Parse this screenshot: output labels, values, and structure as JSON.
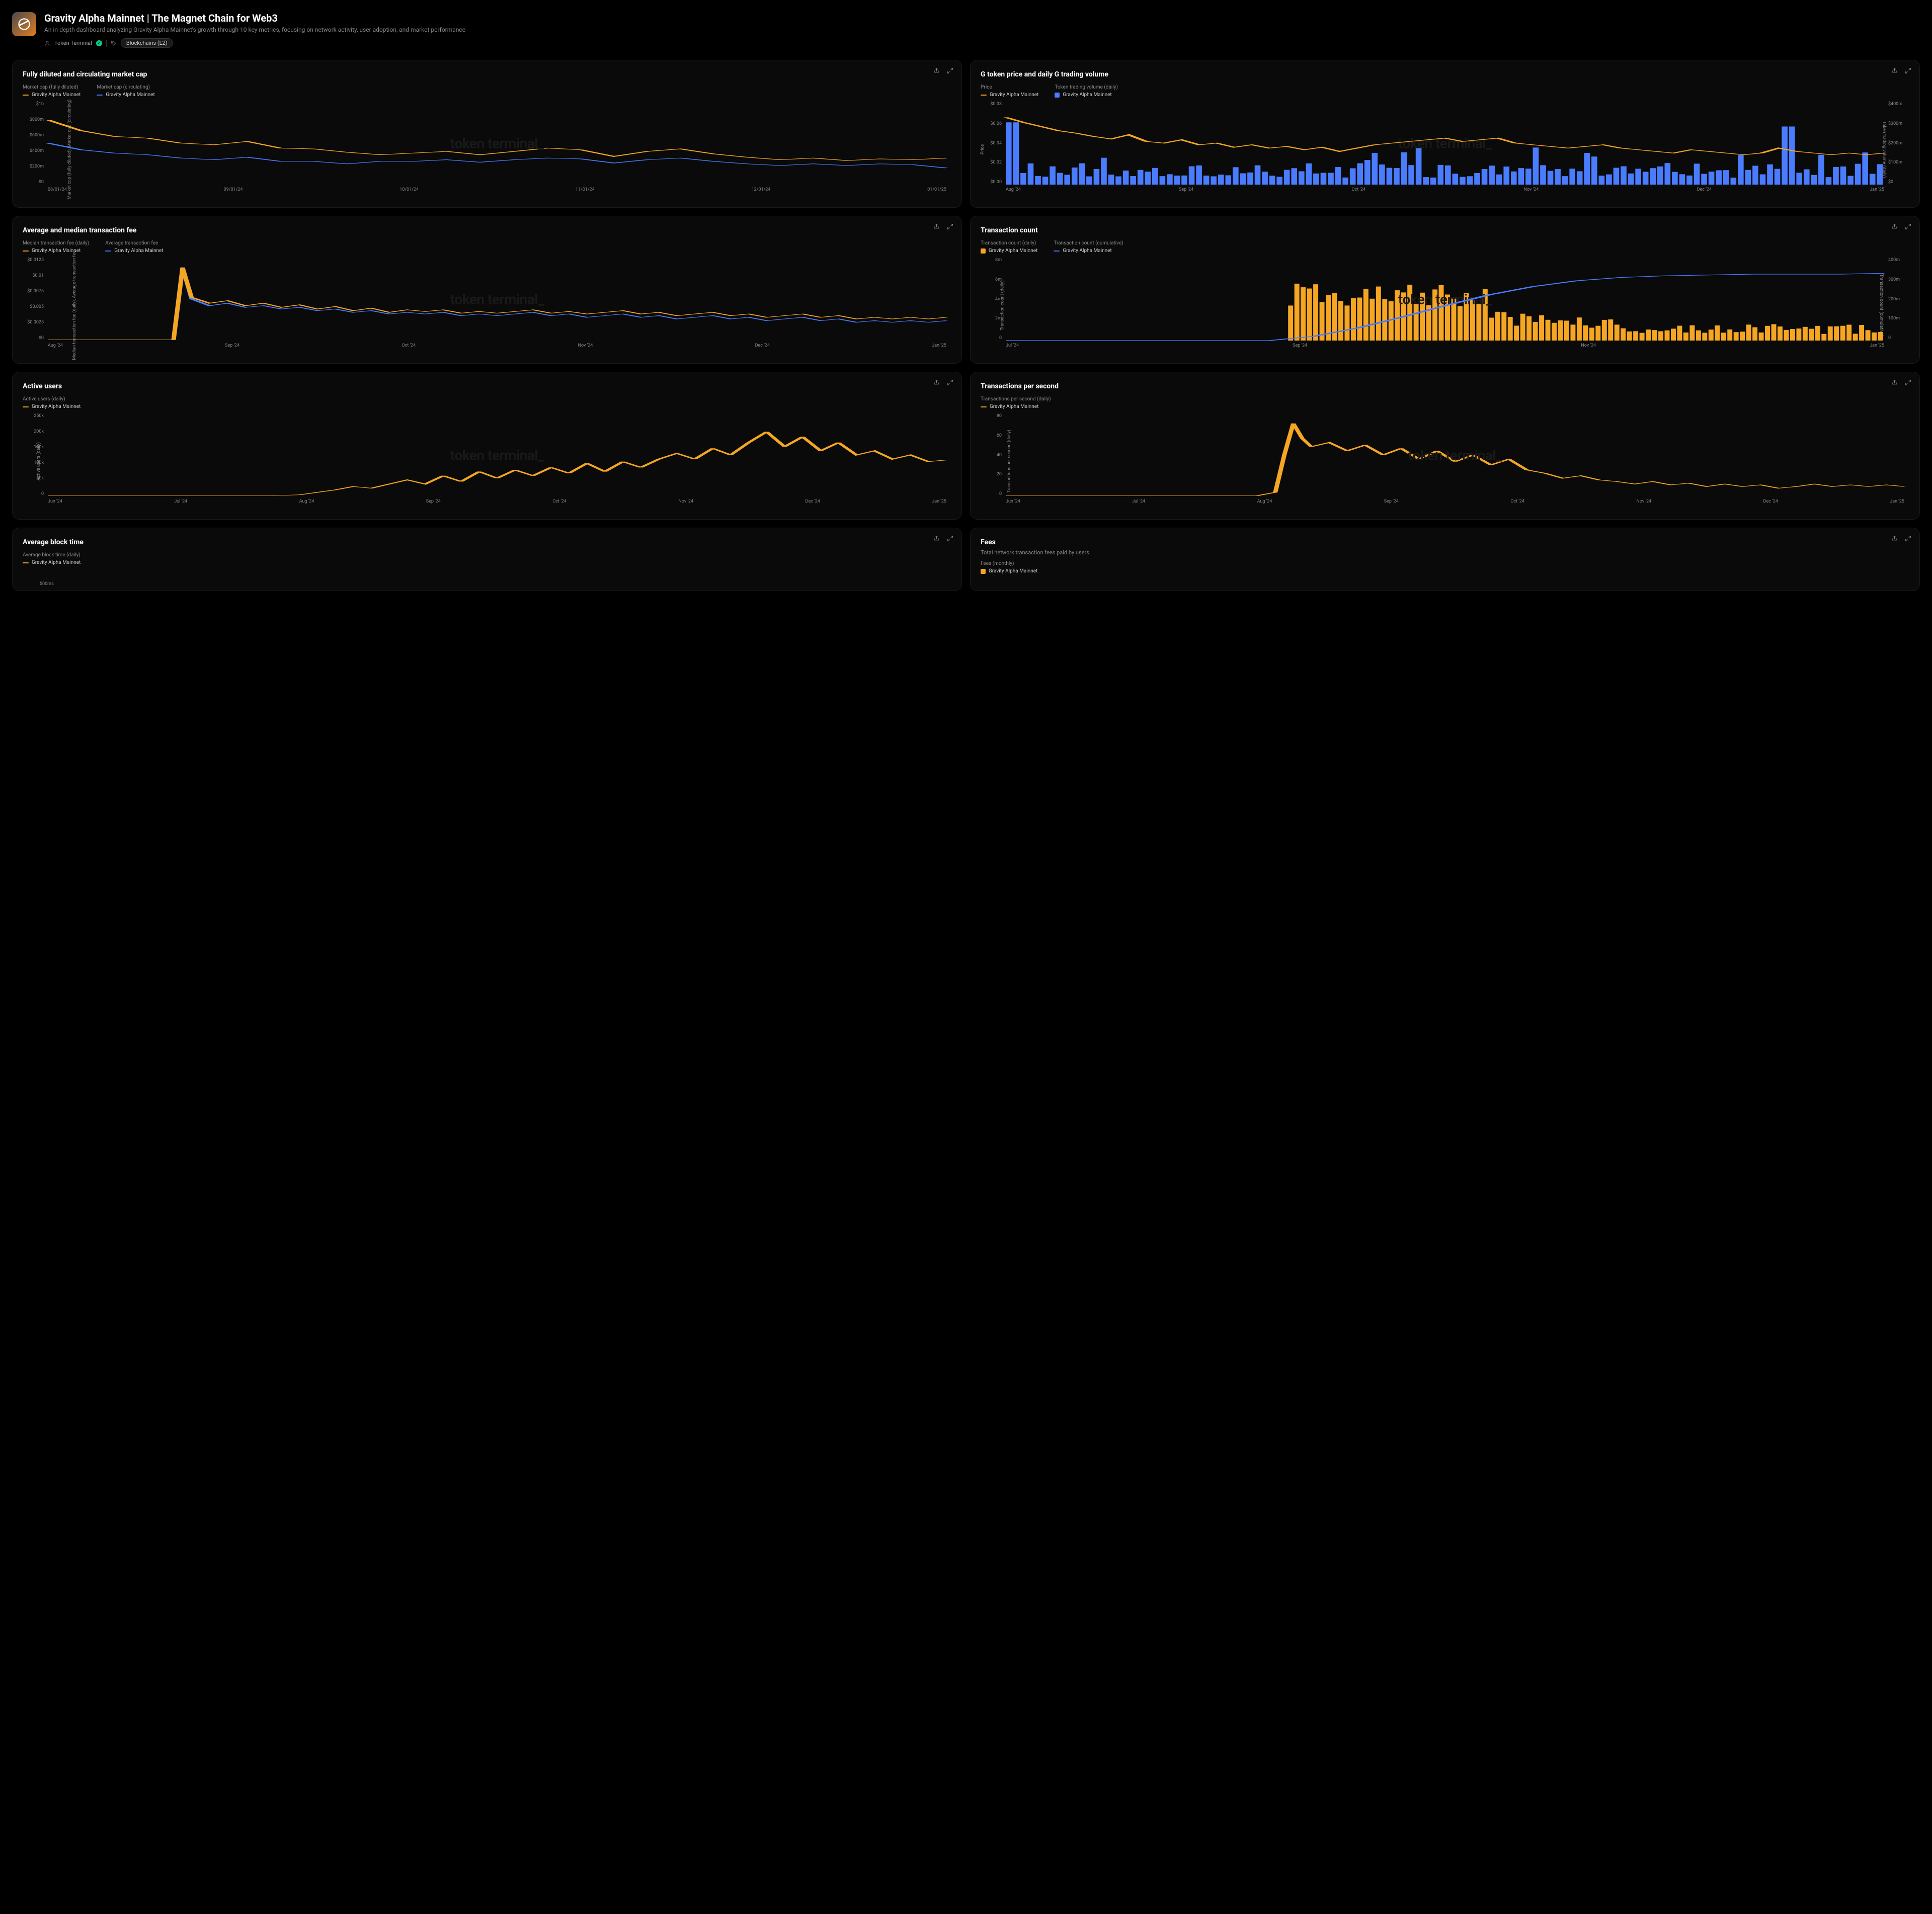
{
  "header": {
    "title": "Gravity Alpha Mainnet | The Magnet Chain for Web3",
    "description": "An in-depth dashboard analyzing Gravity Alpha Mainnet's growth through 10 key metrics, focusing on network activity, user adoption, and market performance",
    "author": "Token Terminal",
    "tag": "Blockchains (L2)"
  },
  "watermark": "token terminal_",
  "legend_entity": "Gravity Alpha Mainnet",
  "cards": [
    {
      "id": "marketcap",
      "title": "Fully diluted and circulating market cap",
      "legends": [
        {
          "label": "Market cap (fully diluted)",
          "style": "line",
          "color": "orange"
        },
        {
          "label": "Market cap (circulating)",
          "style": "line",
          "color": "blue"
        }
      ],
      "y_label": "Market cap (fully diluted), Market cap (circulating)"
    },
    {
      "id": "price_volume",
      "title": "G token price and daily G trading volume",
      "legends": [
        {
          "label": "Price",
          "style": "line",
          "color": "orange"
        },
        {
          "label": "Token trading volume (daily)",
          "style": "box",
          "color": "blue"
        }
      ],
      "y_label": "Price",
      "y2_label": "Token trading volume (daily)"
    },
    {
      "id": "tx_fee",
      "title": "Average and median transaction fee",
      "legends": [
        {
          "label": "Median transaction fee (daily)",
          "style": "line",
          "color": "orange"
        },
        {
          "label": "Average transaction fee",
          "style": "line",
          "color": "blue"
        }
      ],
      "y_label": "Median transaction fee (daily), Average transaction fee"
    },
    {
      "id": "tx_count",
      "title": "Transaction count",
      "legends": [
        {
          "label": "Transaction count (daily)",
          "style": "box",
          "color": "orange"
        },
        {
          "label": "Transaction count (cumulative)",
          "style": "line",
          "color": "blue"
        }
      ],
      "y_label": "Transaction count (daily)",
      "y2_label": "Transaction count (cumulative)"
    },
    {
      "id": "active_users",
      "title": "Active users",
      "legends": [
        {
          "label": "Active users (daily)",
          "style": "line",
          "color": "orange"
        }
      ],
      "y_label": "Active users (daily)"
    },
    {
      "id": "tps",
      "title": "Transactions per second",
      "legends": [
        {
          "label": "Transactions per second (daily)",
          "style": "line",
          "color": "orange"
        }
      ],
      "y_label": "Transactions per second (daily)"
    },
    {
      "id": "block_time",
      "title": "Average block time",
      "legends": [
        {
          "label": "Average block time (daily)",
          "style": "line",
          "color": "orange"
        }
      ],
      "y_ticks": [
        "500ms"
      ]
    },
    {
      "id": "fees",
      "title": "Fees",
      "subtitle": "Total network transaction fees paid by users.",
      "legends": [
        {
          "label": "Fees (monthly)",
          "style": "box",
          "color": "orange"
        }
      ]
    }
  ],
  "chart_data": [
    {
      "id": "marketcap",
      "type": "line",
      "x_ticks": [
        "08/01/24",
        "09/01/24",
        "10/01/24",
        "11/01/24",
        "12/01/24",
        "01/01/25"
      ],
      "y_ticks": [
        "$1b",
        "$800m",
        "$600m",
        "$400m",
        "$200m",
        "$0"
      ],
      "ylim": [
        0,
        1000000000
      ],
      "n": 28,
      "series": [
        {
          "name": "Market cap (fully diluted)",
          "color": "#f5a623",
          "values": [
            780,
            650,
            580,
            560,
            500,
            480,
            520,
            440,
            430,
            390,
            360,
            380,
            400,
            360,
            400,
            440,
            420,
            340,
            400,
            430,
            370,
            330,
            300,
            320,
            290,
            310,
            300,
            320
          ]
        },
        {
          "name": "Market cap (circulating)",
          "color": "#4a7cff",
          "values": [
            500,
            420,
            380,
            360,
            320,
            300,
            330,
            280,
            280,
            250,
            280,
            280,
            300,
            270,
            300,
            320,
            310,
            260,
            300,
            320,
            280,
            250,
            230,
            250,
            230,
            250,
            240,
            200
          ]
        }
      ],
      "unit": "million USD"
    },
    {
      "id": "price_volume",
      "type": "combo",
      "x_ticks": [
        "Aug '24",
        "Sep '24",
        "Oct '24",
        "Nov '24",
        "Dec '24",
        "Jan '25"
      ],
      "y_ticks": [
        "$0.08",
        "$0.06",
        "$0.04",
        "$0.02",
        "$0.00"
      ],
      "y2_ticks": [
        "$400m",
        "$300m",
        "$200m",
        "$100m",
        "$0"
      ],
      "ylim": [
        0,
        0.08
      ],
      "y2lim": [
        0,
        400
      ],
      "n": 120,
      "line": {
        "name": "Price",
        "color": "#f5a623",
        "values_desc": "starts ~0.065, drops to ~0.04-0.05 range with volatility, peaks ~0.045 mid-Dec, ends ~0.03"
      },
      "bars": {
        "name": "Token trading volume (daily)",
        "color": "#4a7cff",
        "values_desc": "initial spike ~300m first day, mostly 20-80m range, occasional spikes to 100-150m, large spike ~280m early Jan"
      }
    },
    {
      "id": "tx_fee",
      "type": "line",
      "x_ticks": [
        "Aug '24",
        "Sep '24",
        "Oct '24",
        "Nov '24",
        "Dec '24",
        "Jan '25"
      ],
      "y_ticks": [
        "$0.0125",
        "$0.01",
        "$0.0075",
        "$0.005",
        "$0.0025",
        "$0"
      ],
      "ylim": [
        0,
        0.0125
      ],
      "n": 170,
      "series": [
        {
          "name": "Median transaction fee (daily)",
          "color": "#f5a623",
          "values_desc": "near 0 until late Aug, spike to 0.011, settles 0.004-0.006, gradual decline to ~0.004"
        },
        {
          "name": "Average transaction fee",
          "color": "#4a7cff",
          "values_desc": "near 0 until late Aug, spike to 0.011, tracks close to median slightly lower, ends ~0.003"
        }
      ]
    },
    {
      "id": "tx_count",
      "type": "combo",
      "x_ticks": [
        "Jul '24",
        "Sep '24",
        "Nov '24",
        "Jan '25"
      ],
      "y_ticks": [
        "8m",
        "6m",
        "4m",
        "2m",
        "0"
      ],
      "y2_ticks": [
        "400m",
        "300m",
        "200m",
        "100m",
        "0"
      ],
      "ylim": [
        0,
        8
      ],
      "y2lim": [
        0,
        400
      ],
      "n": 200,
      "bars": {
        "name": "Transaction count (daily)",
        "color": "#f5a623",
        "values_desc": "near 0 until late Aug, jumps to 4-6m through Sep-Oct, drops to 1-2m Nov onward, small uptick Jan"
      },
      "line": {
        "name": "Transaction count (cumulative)",
        "color": "#4a7cff",
        "values_desc": "S-curve from 0 to ~320m, steep Aug-Nov, flattening after"
      }
    },
    {
      "id": "active_users",
      "type": "line",
      "x_ticks": [
        "Jun '24",
        "Jul '24",
        "Aug '24",
        "Sep '24",
        "Oct '24",
        "Nov '24",
        "Dec '24",
        "Jan '25"
      ],
      "y_ticks": [
        "250k",
        "200k",
        "150k",
        "100k",
        "50k",
        "0"
      ],
      "ylim": [
        0,
        250000
      ],
      "n": 240,
      "series": [
        {
          "name": "Active users (daily)",
          "color": "#f5a623",
          "values_desc": "near 0 through Aug, rises to 40-80k Sep-Nov with high volatility, peaks ~200k late Dec, ends ~110k"
        }
      ]
    },
    {
      "id": "tps",
      "type": "line",
      "x_ticks": [
        "Jun '24",
        "Jul '24",
        "Aug '24",
        "Sep '24",
        "Oct '24",
        "Nov '24",
        "Dec '24",
        "Jan '25"
      ],
      "y_ticks": [
        "80",
        "60",
        "40",
        "20",
        "0"
      ],
      "ylim": [
        0,
        80
      ],
      "n": 240,
      "series": [
        {
          "name": "Transactions per second (daily)",
          "color": "#f5a623",
          "values_desc": "near 0 until late Aug, spike to ~70, volatile 30-55 Sep-Oct, declines to 10-20 Nov-Jan"
        }
      ]
    }
  ]
}
